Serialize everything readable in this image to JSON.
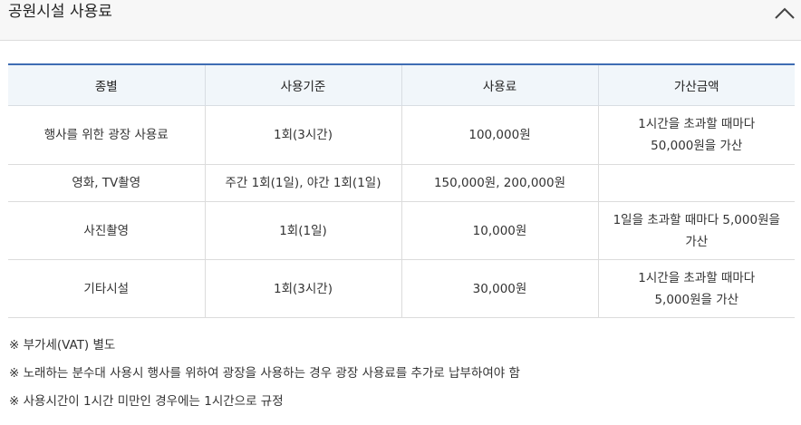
{
  "section": {
    "title": "공원시설 사용료"
  },
  "table": {
    "headers": [
      "종별",
      "사용기준",
      "사용료",
      "가산금액"
    ],
    "rows": [
      {
        "type": "행사를 위한 광장 사용료",
        "basis": "1회(3시간)",
        "fee": "100,000원",
        "surcharge": [
          "1시간을 초과할 때마다",
          "50,000원을 가산"
        ]
      },
      {
        "type": "영화, TV촬영",
        "basis": "주간 1회(1일), 야간 1회(1일)",
        "fee": "150,000원, 200,000원",
        "surcharge": []
      },
      {
        "type": "사진촬영",
        "basis": "1회(1일)",
        "fee": "10,000원",
        "surcharge": [
          "1일을 초과할 때마다 5,000원을",
          "가산"
        ]
      },
      {
        "type": "기타시설",
        "basis": "1회(3시간)",
        "fee": "30,000원",
        "surcharge": [
          "1시간을 초과할 때마다",
          "5,000원을 가산"
        ]
      }
    ]
  },
  "notes": [
    "※ 부가세(VAT) 별도",
    "※ 노래하는 분수대 사용시 행사를 위하여 광장을 사용하는 경우 광장 사용료를 추가로 납부하여야 함",
    "※ 사용시간이 1시간 미만인 경우에는 1시간으로 규정"
  ],
  "icons": {
    "collapse": "chevron-up-icon"
  },
  "colors": {
    "header_bg": "#f1f6fa",
    "header_border": "#3f6db3"
  }
}
